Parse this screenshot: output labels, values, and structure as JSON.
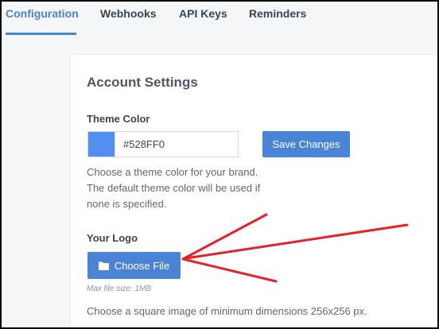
{
  "tabs": [
    {
      "label": "Configuration",
      "active": true
    },
    {
      "label": "Webhooks",
      "active": false
    },
    {
      "label": "API Keys",
      "active": false
    },
    {
      "label": "Reminders",
      "active": false
    }
  ],
  "card": {
    "title": "Account Settings",
    "theme_color": {
      "label": "Theme Color",
      "value": "#528FF0",
      "swatch_color": "#528FF0",
      "save_label": "Save Changes",
      "help_lines": [
        "Choose a theme color for your brand.",
        "The default theme color will be used if",
        "none is specified."
      ]
    },
    "logo": {
      "label": "Your Logo",
      "button_label": "Choose File",
      "button_icon": "folder-icon",
      "max_size": "Max file size: 1MB",
      "help": "Choose a square image of minimum dimensions 256x256 px."
    }
  },
  "annotation": {
    "type": "red-arrow",
    "color": "#e8202a",
    "points_to": "choose-file-button"
  },
  "colors": {
    "accent": "#4a84d6",
    "text": "#3d4550",
    "muted": "#5f6873"
  }
}
